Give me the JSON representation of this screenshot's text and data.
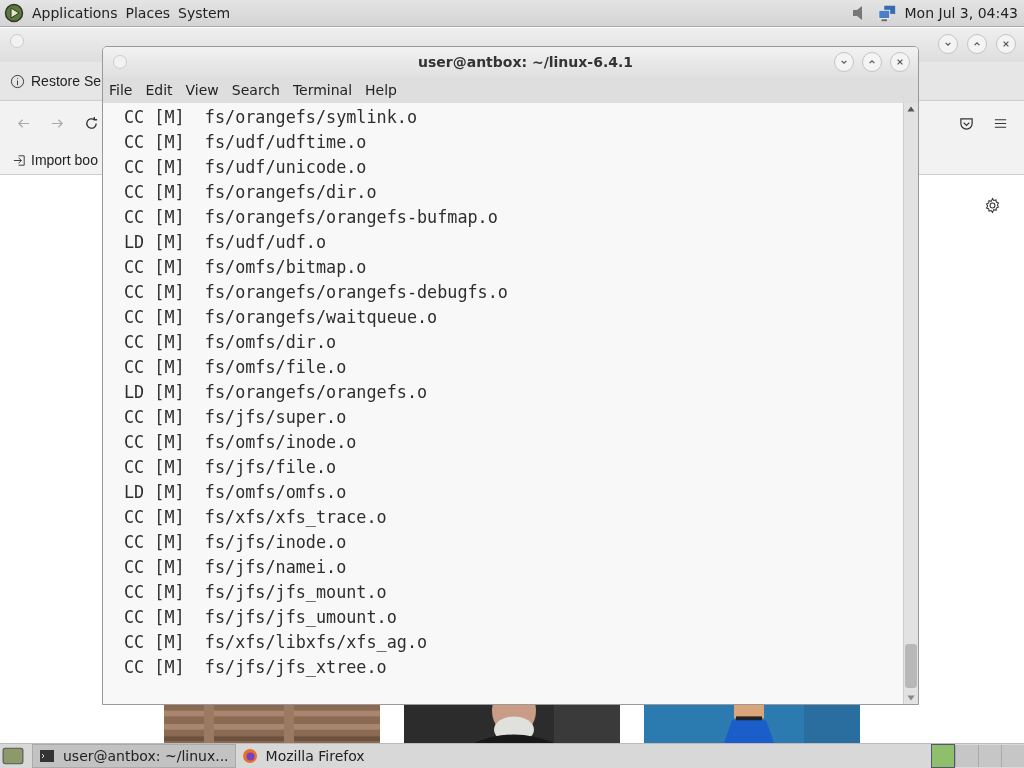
{
  "top_panel": {
    "menus": [
      "Applications",
      "Places",
      "System"
    ],
    "clock": "Mon Jul 3, 04:43"
  },
  "firefox": {
    "notice": "Restore Se",
    "bookmark": "Import boo"
  },
  "terminal": {
    "title": "user@antbox: ~/linux-6.4.1",
    "menu": [
      "File",
      "Edit",
      "View",
      "Search",
      "Terminal",
      "Help"
    ],
    "lines": [
      "CC [M]  fs/orangefs/symlink.o",
      "CC [M]  fs/udf/udftime.o",
      "CC [M]  fs/udf/unicode.o",
      "CC [M]  fs/orangefs/dir.o",
      "CC [M]  fs/orangefs/orangefs-bufmap.o",
      "LD [M]  fs/udf/udf.o",
      "CC [M]  fs/omfs/bitmap.o",
      "CC [M]  fs/orangefs/orangefs-debugfs.o",
      "CC [M]  fs/orangefs/waitqueue.o",
      "CC [M]  fs/omfs/dir.o",
      "CC [M]  fs/omfs/file.o",
      "LD [M]  fs/orangefs/orangefs.o",
      "CC [M]  fs/jfs/super.o",
      "CC [M]  fs/omfs/inode.o",
      "CC [M]  fs/jfs/file.o",
      "LD [M]  fs/omfs/omfs.o",
      "CC [M]  fs/xfs/xfs_trace.o",
      "CC [M]  fs/jfs/inode.o",
      "CC [M]  fs/jfs/namei.o",
      "CC [M]  fs/jfs/jfs_mount.o",
      "CC [M]  fs/jfs/jfs_umount.o",
      "CC [M]  fs/xfs/libxfs/xfs_ag.o",
      "CC [M]  fs/jfs/jfs_xtree.o"
    ]
  },
  "taskbar": {
    "tasks": [
      {
        "label": "user@antbox: ~/linux...",
        "kind": "terminal",
        "selected": true
      },
      {
        "label": "Mozilla Firefox",
        "kind": "browser",
        "selected": false
      }
    ]
  }
}
